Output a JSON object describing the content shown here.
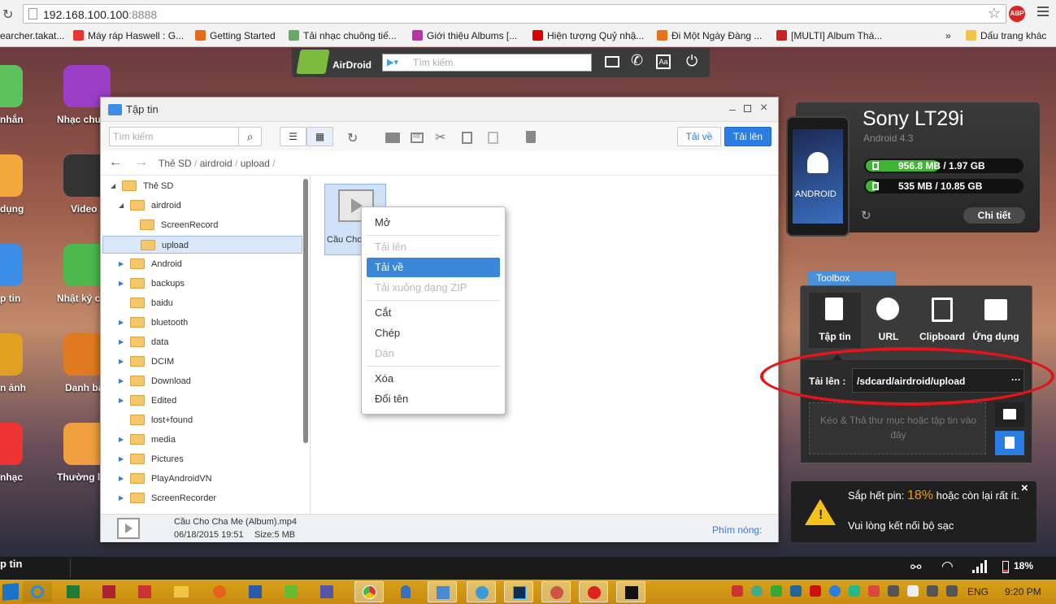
{
  "browser": {
    "url_host": "192.168.100.100",
    "url_port": ":8888",
    "bookmarks": [
      {
        "label": "earcher.takat...",
        "color": "#888"
      },
      {
        "label": "Máy ráp Haswell : G...",
        "color": "#e33"
      },
      {
        "label": "Getting Started",
        "color": "#e66a1a"
      },
      {
        "label": "Tải nhạc chuông tiế...",
        "color": "#6a6"
      },
      {
        "label": "Giới thiệu Albums [...",
        "color": "#b3a"
      },
      {
        "label": "Hiện tượng Quỷ nhậ...",
        "color": "#d00"
      },
      {
        "label": "Đi Một Ngày Đàng ...",
        "color": "#e8711a"
      },
      {
        "label": "[MULTI] Album Thá...",
        "color": "#c22"
      }
    ],
    "more_label": "»",
    "other_bookmarks": "Dấu trang khác",
    "abp_label": "ABP"
  },
  "desktop": {
    "icons": [
      {
        "label": "nhắn",
        "color": "#5cc25c"
      },
      {
        "label": "Nhạc chu",
        "color": "#9b3fc6"
      },
      {
        "label": "dụng",
        "color": "#f3a83b"
      },
      {
        "label": "Video",
        "color": "#333"
      },
      {
        "label": "p tin",
        "color": "#3a8ee6"
      },
      {
        "label": "Nhật ký c",
        "color": "#4db84d"
      },
      {
        "label": "n ảnh",
        "color": "#e0a020"
      },
      {
        "label": "Danh ba",
        "color": "#e07a20"
      },
      {
        "label": "nhạc",
        "color": "#e33"
      },
      {
        "label": "Thường li",
        "color": "#f0a040"
      }
    ],
    "bottom_label": "p tin"
  },
  "airdroid_bar": {
    "logo": "AirDroid",
    "search_placeholder": "Tìm kiếm"
  },
  "file_window": {
    "title": "Tập tin",
    "search_placeholder": "Tìm kiếm",
    "download_label": "Tải về",
    "upload_label": "Tải lên",
    "breadcrumb": [
      "Thẻ SD",
      "airdroid",
      "upload"
    ],
    "tree": [
      {
        "label": "Thẻ SD",
        "level": 0,
        "arrow": "open"
      },
      {
        "label": "airdroid",
        "level": 1,
        "arrow": "open"
      },
      {
        "label": "ScreenRecord",
        "level": 2,
        "arrow": ""
      },
      {
        "label": "upload",
        "level": 2,
        "arrow": "",
        "selected": true
      },
      {
        "label": "Android",
        "level": 1,
        "arrow": "closed"
      },
      {
        "label": "backups",
        "level": 1,
        "arrow": "closed"
      },
      {
        "label": "baidu",
        "level": 1,
        "arrow": ""
      },
      {
        "label": "bluetooth",
        "level": 1,
        "arrow": "closed"
      },
      {
        "label": "data",
        "level": 1,
        "arrow": "closed"
      },
      {
        "label": "DCIM",
        "level": 1,
        "arrow": "closed"
      },
      {
        "label": "Download",
        "level": 1,
        "arrow": "closed"
      },
      {
        "label": "Edited",
        "level": 1,
        "arrow": "closed"
      },
      {
        "label": "lost+found",
        "level": 1,
        "arrow": ""
      },
      {
        "label": "media",
        "level": 1,
        "arrow": "closed"
      },
      {
        "label": "Pictures",
        "level": 1,
        "arrow": "closed"
      },
      {
        "label": "PlayAndroidVN",
        "level": 1,
        "arrow": "closed"
      },
      {
        "label": "ScreenRecorder",
        "level": 1,
        "arrow": "closed"
      }
    ],
    "file_tile_label": "Cầu Cho",
    "status": {
      "filename": "Cầu Cho Cha Me (Album).mp4",
      "date": "06/18/2015 19:51",
      "size": "Size:5 MB",
      "hotkeys": "Phím nóng:"
    }
  },
  "context_menu": {
    "items": [
      {
        "label": "Mở",
        "disabled": false
      },
      {
        "label": "Tải lên",
        "disabled": true
      },
      {
        "label": "Tải về",
        "disabled": false,
        "highlighted": true
      },
      {
        "label": "Tải xuống dạng ZIP",
        "disabled": true
      },
      {
        "label": "Cắt",
        "disabled": false
      },
      {
        "label": "Chép",
        "disabled": false
      },
      {
        "label": "Dán",
        "disabled": true
      },
      {
        "label": "Xóa",
        "disabled": false
      },
      {
        "label": "Đổi tên",
        "disabled": false
      }
    ]
  },
  "device": {
    "name": "Sony LT29i",
    "os": "Android 4.3",
    "phone_label": "ANDROID",
    "storage": [
      {
        "text": "956.8 MB / 1.97 GB",
        "fill": 0.47
      },
      {
        "text": "535 MB / 10.85 GB",
        "fill": 0.05
      }
    ],
    "details_label": "Chi tiết"
  },
  "toolbox": {
    "tab_label": "Toolbox",
    "tabs": [
      "Tập tin",
      "URL",
      "Clipboard",
      "Ứng dụng"
    ],
    "upload_label": "Tải lên :",
    "upload_path": "/sdcard/airdroid/upload",
    "more_label": "···",
    "drop_hint": "Kéo & Thả thư mục hoặc tập tin vào đây"
  },
  "notification": {
    "line1a": "Sắp hết pin: ",
    "percent": "18%",
    "line1b": " hoặc còn lại rất ít.",
    "line2": "Vui lòng kết nối bộ sạc",
    "close": "×"
  },
  "statusbar": {
    "battery": "18%"
  },
  "taskbar": {
    "lang": "ENG",
    "time": "9:20 PM"
  },
  "colors": {
    "accent": "#2a7de1",
    "highlight": "#3a87d8",
    "battery_warn": "#f39c12",
    "annotation": "#e2141c"
  }
}
